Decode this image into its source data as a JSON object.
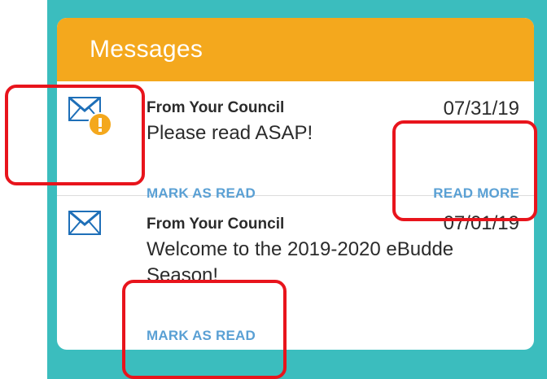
{
  "panel": {
    "title": "Messages",
    "accent_color": "#f4a81d",
    "background_color": "#3bbdbe",
    "link_color": "#5aa0d4",
    "annotation_color": "#e8141c"
  },
  "messages": [
    {
      "icon": "envelope-icon",
      "badge_icon": "alert-badge-icon",
      "sender": "From Your Council",
      "date": "07/31/19",
      "body": "Please read ASAP!",
      "mark_label": "MARK AS READ",
      "more_label": "READ MORE"
    },
    {
      "icon": "envelope-icon",
      "sender": "From Your Council",
      "date": "07/01/19",
      "body": "Welcome to the 2019-2020 eBudde Season!",
      "mark_label": "MARK AS READ"
    }
  ]
}
